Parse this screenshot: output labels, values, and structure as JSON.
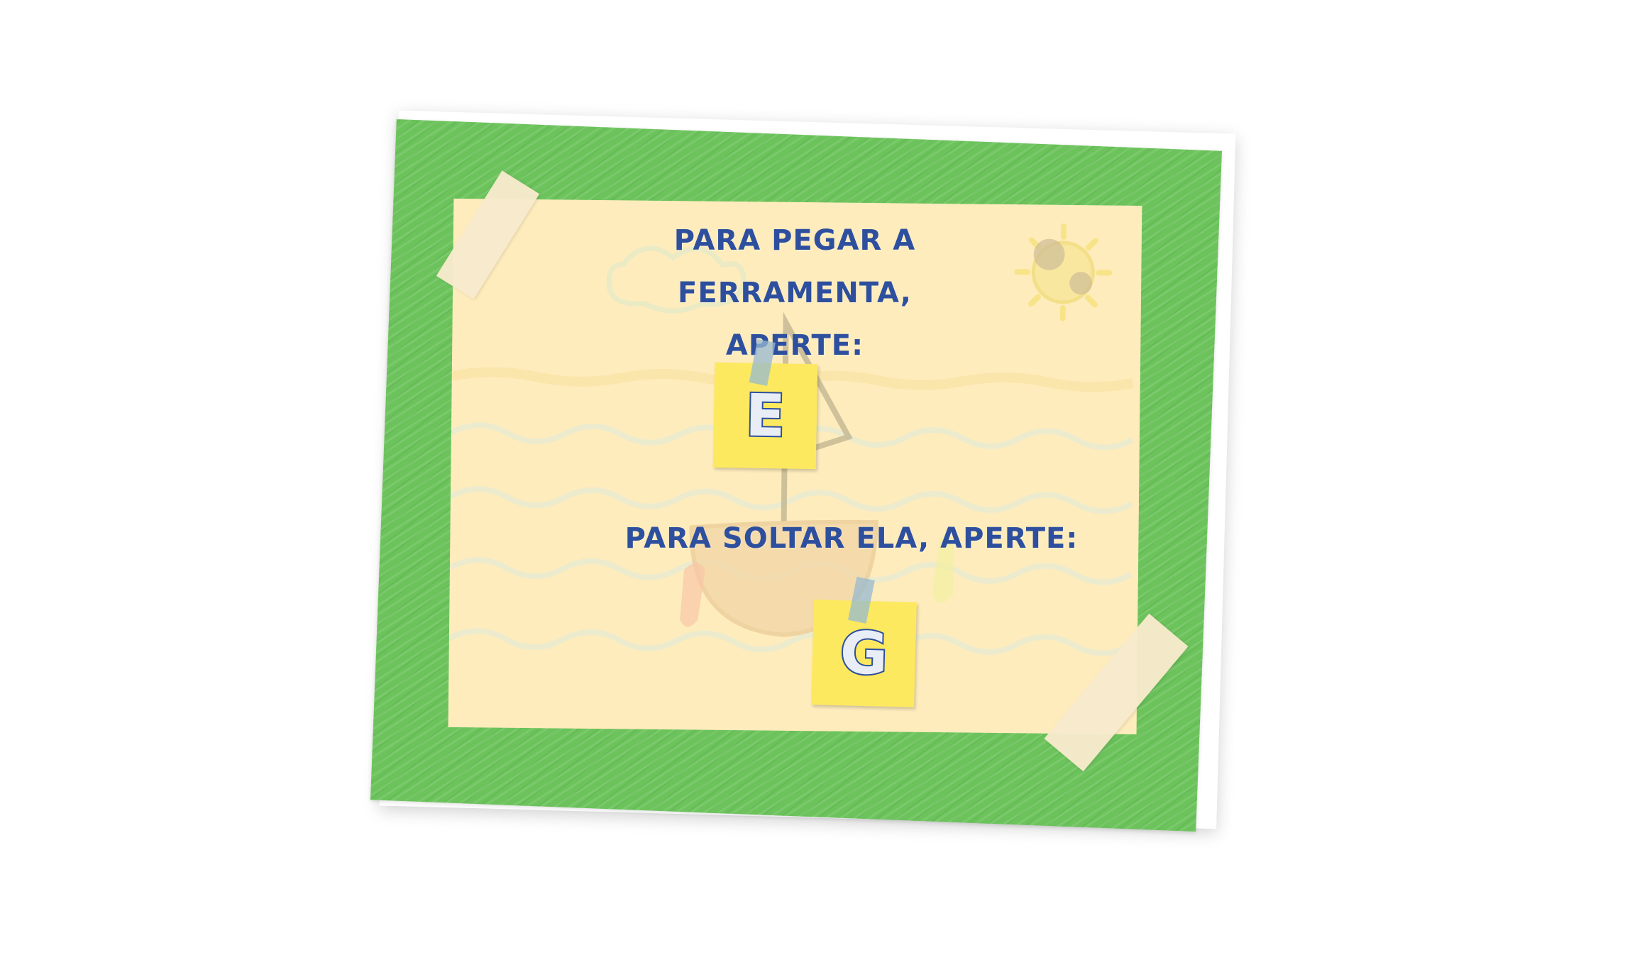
{
  "instructions": {
    "pick_up_line1": "PARA PEGAR A FERRAMENTA,",
    "pick_up_line2": "APERTE:",
    "drop": "PARA SOLTAR ELA, APERTE:"
  },
  "keys": {
    "pick_up": "E",
    "drop": "G"
  },
  "colors": {
    "board": "#6cc35c",
    "paper": "#fde9b5",
    "text": "#2d4f9e",
    "sticky_note": "#fde95f"
  },
  "icons": {
    "tape": "tape-strip-icon",
    "sticky_pin": "tape-pin-icon"
  }
}
